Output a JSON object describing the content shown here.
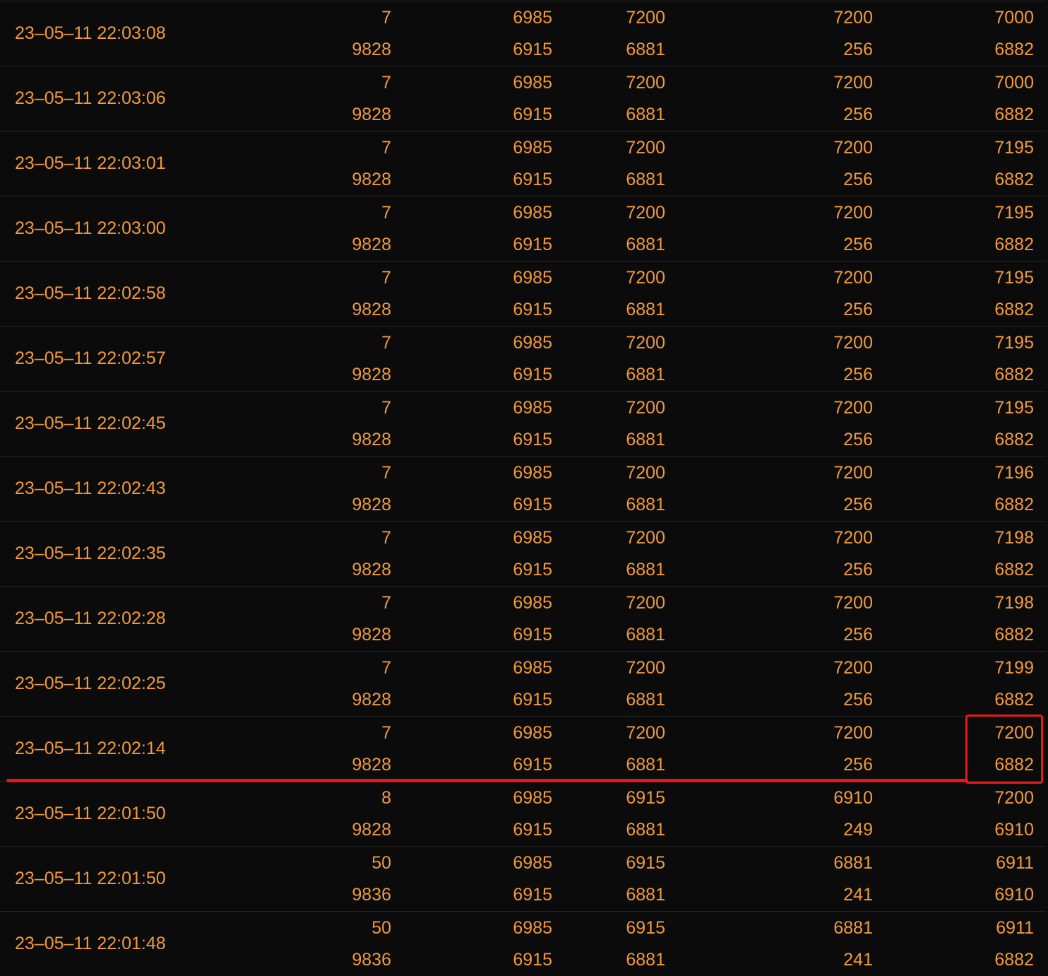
{
  "rows": [
    {
      "time": "23–05–11 22:03:08",
      "top": [
        "7",
        "6985",
        "7200",
        "7200",
        "7000"
      ],
      "bottom": [
        "9828",
        "6915",
        "6881",
        "256",
        "6882"
      ]
    },
    {
      "time": "23–05–11 22:03:06",
      "top": [
        "7",
        "6985",
        "7200",
        "7200",
        "7000"
      ],
      "bottom": [
        "9828",
        "6915",
        "6881",
        "256",
        "6882"
      ]
    },
    {
      "time": "23–05–11 22:03:01",
      "top": [
        "7",
        "6985",
        "7200",
        "7200",
        "7195"
      ],
      "bottom": [
        "9828",
        "6915",
        "6881",
        "256",
        "6882"
      ]
    },
    {
      "time": "23–05–11 22:03:00",
      "top": [
        "7",
        "6985",
        "7200",
        "7200",
        "7195"
      ],
      "bottom": [
        "9828",
        "6915",
        "6881",
        "256",
        "6882"
      ]
    },
    {
      "time": "23–05–11 22:02:58",
      "top": [
        "7",
        "6985",
        "7200",
        "7200",
        "7195"
      ],
      "bottom": [
        "9828",
        "6915",
        "6881",
        "256",
        "6882"
      ]
    },
    {
      "time": "23–05–11 22:02:57",
      "top": [
        "7",
        "6985",
        "7200",
        "7200",
        "7195"
      ],
      "bottom": [
        "9828",
        "6915",
        "6881",
        "256",
        "6882"
      ]
    },
    {
      "time": "23–05–11 22:02:45",
      "top": [
        "7",
        "6985",
        "7200",
        "7200",
        "7195"
      ],
      "bottom": [
        "9828",
        "6915",
        "6881",
        "256",
        "6882"
      ]
    },
    {
      "time": "23–05–11 22:02:43",
      "top": [
        "7",
        "6985",
        "7200",
        "7200",
        "7196"
      ],
      "bottom": [
        "9828",
        "6915",
        "6881",
        "256",
        "6882"
      ]
    },
    {
      "time": "23–05–11 22:02:35",
      "top": [
        "7",
        "6985",
        "7200",
        "7200",
        "7198"
      ],
      "bottom": [
        "9828",
        "6915",
        "6881",
        "256",
        "6882"
      ]
    },
    {
      "time": "23–05–11 22:02:28",
      "top": [
        "7",
        "6985",
        "7200",
        "7200",
        "7198"
      ],
      "bottom": [
        "9828",
        "6915",
        "6881",
        "256",
        "6882"
      ]
    },
    {
      "time": "23–05–11 22:02:25",
      "top": [
        "7",
        "6985",
        "7200",
        "7200",
        "7199"
      ],
      "bottom": [
        "9828",
        "6915",
        "6881",
        "256",
        "6882"
      ]
    },
    {
      "time": "23–05–11 22:02:14",
      "top": [
        "7",
        "6985",
        "7200",
        "7200",
        "7200"
      ],
      "bottom": [
        "9828",
        "6915",
        "6881",
        "256",
        "6882"
      ]
    },
    {
      "time": "23–05–11 22:01:50",
      "top": [
        "8",
        "6985",
        "6915",
        "6910",
        "7200"
      ],
      "bottom": [
        "9828",
        "6915",
        "6881",
        "249",
        "6910"
      ]
    },
    {
      "time": "23–05–11 22:01:50",
      "top": [
        "50",
        "6985",
        "6915",
        "6881",
        "6911"
      ],
      "bottom": [
        "9836",
        "6915",
        "6881",
        "241",
        "6910"
      ]
    },
    {
      "time": "23–05–11 22:01:48",
      "top": [
        "50",
        "6985",
        "6915",
        "6881",
        "6911"
      ],
      "bottom": [
        "9836",
        "6915",
        "6881",
        "241",
        "6882"
      ]
    }
  ],
  "colors": {
    "background": "#0b0b0b",
    "text": "#f29a3a",
    "divider": "#262626",
    "annotation": "#e21a1a"
  }
}
